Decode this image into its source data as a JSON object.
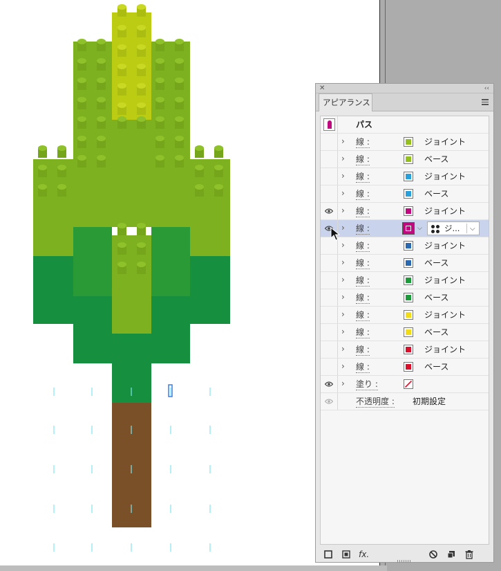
{
  "panel": {
    "tab_label": "アピアランス",
    "close_glyph": "✕",
    "collapse_glyph": "‹‹",
    "menu_icon": "hamburger-menu-icon"
  },
  "colors": {
    "selection_row": "#c9d3ec",
    "guide_cyan": "#7ee7f0",
    "trunk": "#7a5028"
  },
  "header_row": {
    "label": "パス",
    "thumb_color": "#c0087f"
  },
  "strokes": [
    {
      "label": "線 :",
      "color": "#93c01f",
      "value": "ジョイント",
      "visible": false
    },
    {
      "label": "線 :",
      "color": "#93c01f",
      "value": "ベース",
      "visible": false
    },
    {
      "label": "線 :",
      "color": "#28a0dc",
      "value": "ジョイント",
      "visible": false
    },
    {
      "label": "線 :",
      "color": "#28a0dc",
      "value": "ベース",
      "visible": false
    },
    {
      "label": "線 :",
      "color": "#c0087f",
      "value": "ジョイント",
      "visible": true
    },
    {
      "label": "線 :",
      "color": "#c0087f",
      "value": "ジ...",
      "visible": true,
      "selected": true
    },
    {
      "label": "線 :",
      "color": "#2a68b0",
      "value": "ジョイント",
      "visible": false
    },
    {
      "label": "線 :",
      "color": "#2a68b0",
      "value": "ベース",
      "visible": false
    },
    {
      "label": "線 :",
      "color": "#1d9a3a",
      "value": "ジョイント",
      "visible": false
    },
    {
      "label": "線 :",
      "color": "#1d9a3a",
      "value": "ベース",
      "visible": false
    },
    {
      "label": "線 :",
      "color": "#f2dc1a",
      "value": "ジョイント",
      "visible": false
    },
    {
      "label": "線 :",
      "color": "#f2dc1a",
      "value": "ベース",
      "visible": false
    },
    {
      "label": "線 :",
      "color": "#d8102c",
      "value": "ジョイント",
      "visible": false
    },
    {
      "label": "線 :",
      "color": "#d8102c",
      "value": "ベース",
      "visible": false
    }
  ],
  "fill_row": {
    "label": "塗り :",
    "visible": true,
    "swatch": "none-slash"
  },
  "opacity_row": {
    "label": "不透明度 :",
    "value": "初期設定"
  },
  "footer_icons": [
    "add-new-stroke-icon",
    "add-new-fill-icon",
    "fx-icon",
    "clear-appearance-icon",
    "duplicate-item-icon",
    "delete-item-icon"
  ],
  "footer_fx": "fx."
}
